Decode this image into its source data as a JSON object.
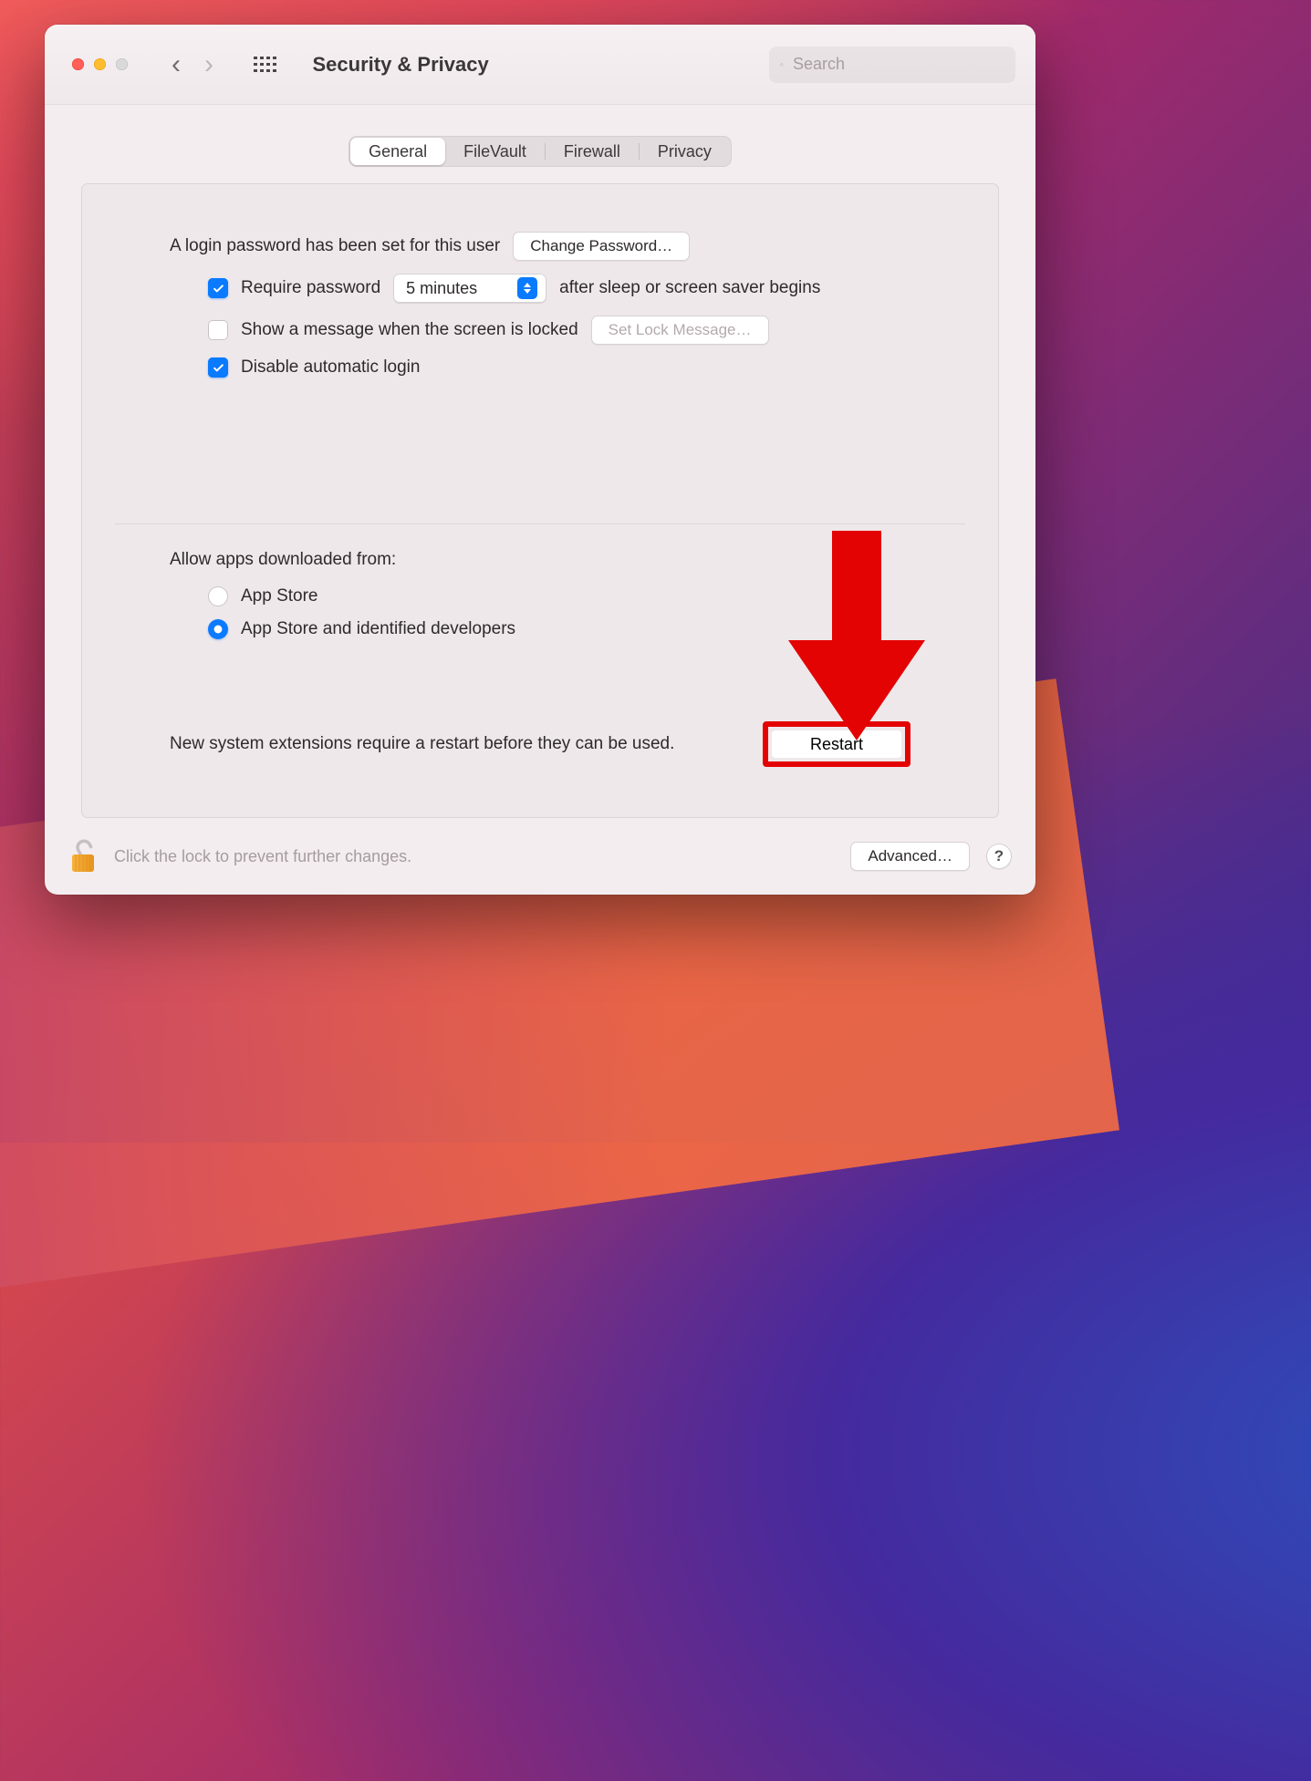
{
  "window": {
    "title": "Security & Privacy"
  },
  "search": {
    "placeholder": "Search"
  },
  "tabs": {
    "general": "General",
    "filevault": "FileVault",
    "firewall": "Firewall",
    "privacy": "Privacy"
  },
  "general": {
    "login_password_set": "A login password has been set for this user",
    "change_password": "Change Password…",
    "require_password_pre": "Require password",
    "require_password_delay": "5 minutes",
    "require_password_post": "after sleep or screen saver begins",
    "show_message": "Show a message when the screen is locked",
    "set_lock_message": "Set Lock Message…",
    "disable_auto_login": "Disable automatic login",
    "checks": {
      "require_password": true,
      "show_message": false,
      "disable_auto_login": true
    }
  },
  "gatekeeper": {
    "label": "Allow apps downloaded from:",
    "option_app_store": "App Store",
    "option_identified": "App Store and identified developers",
    "selected": "identified"
  },
  "extensions": {
    "message": "New system extensions require a restart before they can be used.",
    "restart": "Restart"
  },
  "footer": {
    "lock_text": "Click the lock to prevent further changes.",
    "advanced": "Advanced…",
    "help": "?"
  },
  "colors": {
    "accent": "#0a7aff",
    "highlight": "#e40303"
  }
}
